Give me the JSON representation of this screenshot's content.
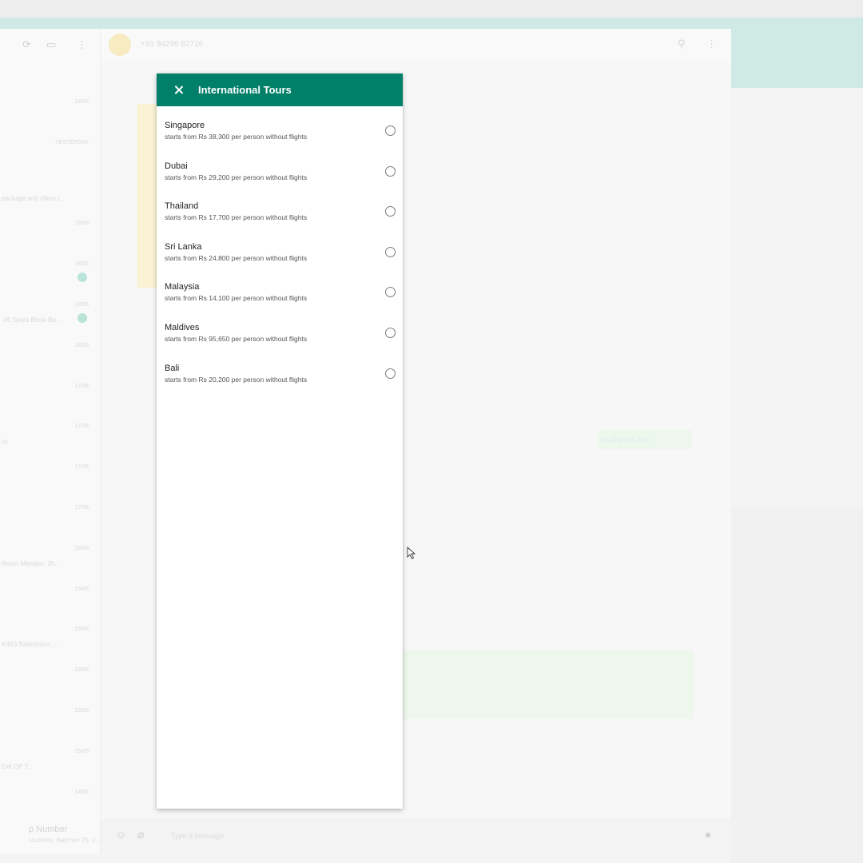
{
  "background": {
    "contact_phone": "+91 94296 92716",
    "chat_list": [
      {
        "time": "18/06",
        "snippet": ""
      },
      {
        "time": "YESTERDAY",
        "snippet": ""
      },
      {
        "time": "",
        "snippet": "package and offers r..."
      },
      {
        "time": "18/06",
        "snippet": ""
      },
      {
        "time": "18/06",
        "snippet": ""
      },
      {
        "time": "18/05",
        "snippet": "-45 Seats Block Ba..."
      },
      {
        "time": "18/05",
        "snippet": ""
      },
      {
        "time": "17/06",
        "snippet": ""
      },
      {
        "time": "17/06",
        "snippet": "ss"
      },
      {
        "time": "17/06",
        "snippet": ""
      },
      {
        "time": "17/06",
        "snippet": ""
      },
      {
        "time": "16/06",
        "snippet": "Room Member: 20..."
      },
      {
        "time": "15/06",
        "snippet": ""
      },
      {
        "time": "15/06",
        "snippet": "KING Badminton: ..."
      },
      {
        "time": "15/06",
        "snippet": ""
      },
      {
        "time": "15/06",
        "snippet": ""
      },
      {
        "time": "15/06",
        "snippet": "Get OP T..."
      },
      {
        "time": "14/06",
        "snippet": ""
      }
    ],
    "outgoing_email": "fav@gmail.com",
    "composer_placeholder": "Type a message",
    "bottom_label": "p Number",
    "bottom_sub": "students, Batches 25, s..."
  },
  "panel": {
    "title": "International Tours",
    "accent": "#008069",
    "options": [
      {
        "title": "Singapore",
        "subtitle": "starts from Rs 38,300 per person without flights"
      },
      {
        "title": "Dubai",
        "subtitle": "starts from Rs 29,200 per person without flights"
      },
      {
        "title": "Thailand",
        "subtitle": "starts from Rs 17,700 per person without flights"
      },
      {
        "title": "Sri Lanka",
        "subtitle": "starts from Rs 24,800 per person without flights"
      },
      {
        "title": "Malaysia",
        "subtitle": "starts from Rs 14,100 per person without flights"
      },
      {
        "title": "Maldives",
        "subtitle": "starts from Rs 95,650 per person without flights"
      },
      {
        "title": "Bali",
        "subtitle": "starts from Rs 20,200 per person without flights"
      }
    ]
  }
}
